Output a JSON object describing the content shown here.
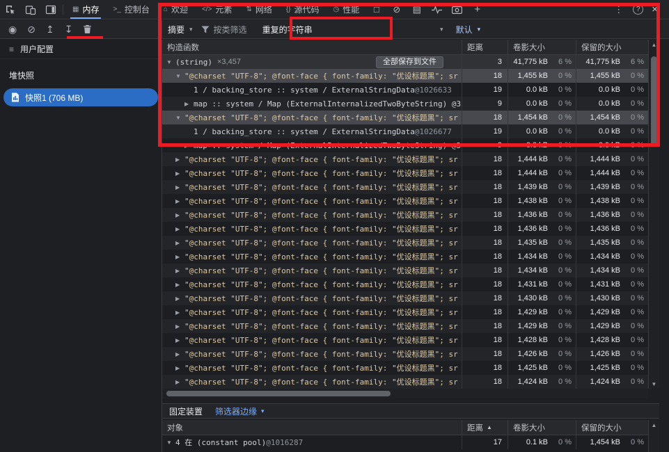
{
  "icon_glyphs": {
    "record": "◉",
    "clear": "⊘",
    "load": "↥",
    "save": "↧",
    "square": "□",
    "block": "⊘",
    "doc": "▤",
    "plus": "+",
    "more": "⋮",
    "help": "?",
    "close": "×",
    "caret": "▾",
    "sort_asc": "▲",
    "scroll_up": "▲",
    "scroll_down": "▼",
    "profiles": "≡"
  },
  "tabbar": {
    "tabs": [
      {
        "label": "内存",
        "glyph": "▦",
        "active": true
      },
      {
        "label": "控制台",
        "glyph": ">_",
        "active": false
      },
      {
        "label": "欢迎",
        "glyph": "⌂",
        "active": false
      },
      {
        "label": "元素",
        "glyph": "</>",
        "active": false
      },
      {
        "label": "网络",
        "glyph": "⇅",
        "active": false
      },
      {
        "label": "源代码",
        "glyph": "{}",
        "active": false
      },
      {
        "label": "性能",
        "glyph": "◷",
        "active": false
      }
    ]
  },
  "filter_toolbar": {
    "summary": "摘要",
    "class_filter": "按类筛选",
    "duplicated": "重复的字符串",
    "default": "默认"
  },
  "sidebar": {
    "profiles": "用户配置",
    "heap_section": "堆快照",
    "snapshot": "快照1 (706 MB)"
  },
  "grid": {
    "columns": [
      "构造函数",
      "距离",
      "卷影大小",
      "保留的大小"
    ],
    "save_button": "全部保存到文件",
    "rows": [
      {
        "lvl": 0,
        "exp": "open",
        "kind": "plain",
        "text": "(string)",
        "suffix": "×3,457",
        "button": true,
        "dist": "3",
        "sv": "41,775 kB",
        "sp": "6 %",
        "rv": "41,775 kB",
        "rp": "6 %",
        "state": "hover"
      },
      {
        "lvl": 1,
        "exp": "open",
        "kind": "string",
        "text": "\"@charset \"UTF-8\"; @font-face { font-family: \"优设标题黑\"; sr",
        "dist": "18",
        "sv": "1,455 kB",
        "sp": "0 %",
        "rv": "1,455 kB",
        "rp": "0 %",
        "state": "selected"
      },
      {
        "lvl": 2,
        "exp": "",
        "kind": "plain",
        "text": "1 / backing_store :: system / ExternalStringData",
        "id": "@1026633",
        "dist": "19",
        "sv": "0.0 kB",
        "sp": "0 %",
        "rv": "0.0 kB",
        "rp": "0 %",
        "state": ""
      },
      {
        "lvl": 2,
        "exp": "closed",
        "kind": "plain",
        "text": "map :: system / Map (ExternalInternalizedTwoByteString) @3",
        "dist": "9",
        "sv": "0.0 kB",
        "sp": "0 %",
        "rv": "0.0 kB",
        "rp": "0 %",
        "state": ""
      },
      {
        "lvl": 1,
        "exp": "open",
        "kind": "string",
        "text": "\"@charset \"UTF-8\"; @font-face { font-family: \"优设标题黑\"; sr",
        "dist": "18",
        "sv": "1,454 kB",
        "sp": "0 %",
        "rv": "1,454 kB",
        "rp": "0 %",
        "state": "selected"
      },
      {
        "lvl": 2,
        "exp": "",
        "kind": "plain",
        "text": "1 / backing_store :: system / ExternalStringData",
        "id": "@1026677",
        "dist": "19",
        "sv": "0.0 kB",
        "sp": "0 %",
        "rv": "0.0 kB",
        "rp": "0 %",
        "state": ""
      },
      {
        "lvl": 2,
        "exp": "closed",
        "kind": "plain",
        "text": "map :: system / Map (ExternalInternalizedTwoByteString) @3",
        "dist": "9",
        "sv": "0.0 kB",
        "sp": "0 %",
        "rv": "0.0 kB",
        "rp": "0 %",
        "state": ""
      },
      {
        "lvl": 1,
        "exp": "closed",
        "kind": "string",
        "text": "\"@charset \"UTF-8\"; @font-face { font-family: \"优设标题黑\"; sr",
        "dist": "18",
        "sv": "1,444 kB",
        "sp": "0 %",
        "rv": "1,444 kB",
        "rp": "0 %",
        "state": ""
      },
      {
        "lvl": 1,
        "exp": "closed",
        "kind": "string",
        "text": "\"@charset \"UTF-8\"; @font-face { font-family: \"优设标题黑\"; sr",
        "dist": "18",
        "sv": "1,444 kB",
        "sp": "0 %",
        "rv": "1,444 kB",
        "rp": "0 %",
        "state": ""
      },
      {
        "lvl": 1,
        "exp": "closed",
        "kind": "string",
        "text": "\"@charset \"UTF-8\"; @font-face { font-family: \"优设标题黑\"; sr",
        "dist": "18",
        "sv": "1,439 kB",
        "sp": "0 %",
        "rv": "1,439 kB",
        "rp": "0 %",
        "state": ""
      },
      {
        "lvl": 1,
        "exp": "closed",
        "kind": "string",
        "text": "\"@charset \"UTF-8\"; @font-face { font-family: \"优设标题黑\"; sr",
        "dist": "18",
        "sv": "1,438 kB",
        "sp": "0 %",
        "rv": "1,438 kB",
        "rp": "0 %",
        "state": ""
      },
      {
        "lvl": 1,
        "exp": "closed",
        "kind": "string",
        "text": "\"@charset \"UTF-8\"; @font-face { font-family: \"优设标题黑\"; sr",
        "dist": "18",
        "sv": "1,436 kB",
        "sp": "0 %",
        "rv": "1,436 kB",
        "rp": "0 %",
        "state": ""
      },
      {
        "lvl": 1,
        "exp": "closed",
        "kind": "string",
        "text": "\"@charset \"UTF-8\"; @font-face { font-family: \"优设标题黑\"; sr",
        "dist": "18",
        "sv": "1,436 kB",
        "sp": "0 %",
        "rv": "1,436 kB",
        "rp": "0 %",
        "state": ""
      },
      {
        "lvl": 1,
        "exp": "closed",
        "kind": "string",
        "text": "\"@charset \"UTF-8\"; @font-face { font-family: \"优设标题黑\"; sr",
        "dist": "18",
        "sv": "1,435 kB",
        "sp": "0 %",
        "rv": "1,435 kB",
        "rp": "0 %",
        "state": ""
      },
      {
        "lvl": 1,
        "exp": "closed",
        "kind": "string",
        "text": "\"@charset \"UTF-8\"; @font-face { font-family: \"优设标题黑\"; sr",
        "dist": "18",
        "sv": "1,434 kB",
        "sp": "0 %",
        "rv": "1,434 kB",
        "rp": "0 %",
        "state": ""
      },
      {
        "lvl": 1,
        "exp": "closed",
        "kind": "string",
        "text": "\"@charset \"UTF-8\"; @font-face { font-family: \"优设标题黑\"; sr",
        "dist": "18",
        "sv": "1,434 kB",
        "sp": "0 %",
        "rv": "1,434 kB",
        "rp": "0 %",
        "state": ""
      },
      {
        "lvl": 1,
        "exp": "closed",
        "kind": "string",
        "text": "\"@charset \"UTF-8\"; @font-face { font-family: \"优设标题黑\"; sr",
        "dist": "18",
        "sv": "1,431 kB",
        "sp": "0 %",
        "rv": "1,431 kB",
        "rp": "0 %",
        "state": ""
      },
      {
        "lvl": 1,
        "exp": "closed",
        "kind": "string",
        "text": "\"@charset \"UTF-8\"; @font-face { font-family: \"优设标题黑\"; sr",
        "dist": "18",
        "sv": "1,430 kB",
        "sp": "0 %",
        "rv": "1,430 kB",
        "rp": "0 %",
        "state": ""
      },
      {
        "lvl": 1,
        "exp": "closed",
        "kind": "string",
        "text": "\"@charset \"UTF-8\"; @font-face { font-family: \"优设标题黑\"; sr",
        "dist": "18",
        "sv": "1,429 kB",
        "sp": "0 %",
        "rv": "1,429 kB",
        "rp": "0 %",
        "state": ""
      },
      {
        "lvl": 1,
        "exp": "closed",
        "kind": "string",
        "text": "\"@charset \"UTF-8\"; @font-face { font-family: \"优设标题黑\"; sr",
        "dist": "18",
        "sv": "1,429 kB",
        "sp": "0 %",
        "rv": "1,429 kB",
        "rp": "0 %",
        "state": ""
      },
      {
        "lvl": 1,
        "exp": "closed",
        "kind": "string",
        "text": "\"@charset \"UTF-8\"; @font-face { font-family: \"优设标题黑\"; sr",
        "dist": "18",
        "sv": "1,428 kB",
        "sp": "0 %",
        "rv": "1,428 kB",
        "rp": "0 %",
        "state": ""
      },
      {
        "lvl": 1,
        "exp": "closed",
        "kind": "string",
        "text": "\"@charset \"UTF-8\"; @font-face { font-family: \"优设标题黑\"; sr",
        "dist": "18",
        "sv": "1,426 kB",
        "sp": "0 %",
        "rv": "1,426 kB",
        "rp": "0 %",
        "state": ""
      },
      {
        "lvl": 1,
        "exp": "closed",
        "kind": "string",
        "text": "\"@charset \"UTF-8\"; @font-face { font-family: \"优设标题黑\"; sr",
        "dist": "18",
        "sv": "1,425 kB",
        "sp": "0 %",
        "rv": "1,425 kB",
        "rp": "0 %",
        "state": ""
      },
      {
        "lvl": 1,
        "exp": "closed",
        "kind": "string",
        "text": "\"@charset \"UTF-8\"; @font-face { font-family: \"优设标题黑\"; sr",
        "dist": "18",
        "sv": "1,424 kB",
        "sp": "0 %",
        "rv": "1,424 kB",
        "rp": "0 %",
        "state": ""
      }
    ]
  },
  "retainers": {
    "title": "固定装置",
    "filter_label": "筛选器边缘",
    "columns": [
      "对象",
      "距离",
      "卷影大小",
      "保留的大小"
    ],
    "rows": [
      {
        "lvl": 0,
        "exp": "open",
        "kind": "plain",
        "text": "4 在 (constant pool)",
        "id": "@1016287",
        "dist": "17",
        "sv": "0.1 kB",
        "sp": "0 %",
        "rv": "1,454 kB",
        "rp": "0 %",
        "state": ""
      }
    ]
  }
}
